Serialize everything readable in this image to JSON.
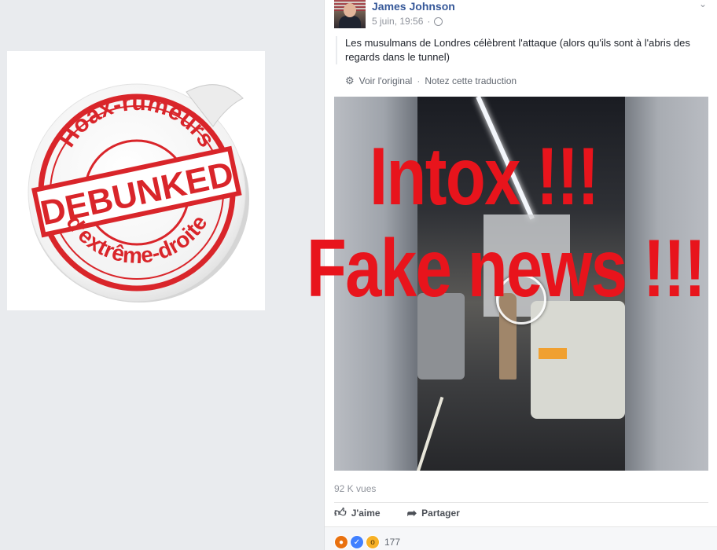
{
  "stamp": {
    "top_text": "Hoax-rumeurs",
    "band_text": "DEBUNKED",
    "bottom_text": "d'extrême-droite",
    "ink_color": "#d9252a"
  },
  "post": {
    "author": "James Johnson",
    "date": "5 juin, 19:56",
    "privacy_icon": "globe-icon",
    "text": "Les musulmans de Londres célèbrent l'attaque (alors qu'ils sont à l'abris des regards dans le tunnel)",
    "translation": {
      "see_original": "Voir l'original",
      "separator": "·",
      "rate_translation": "Notez cette traduction"
    }
  },
  "overlay": {
    "line1": "Intox !!!",
    "line2": "Fake news !!!",
    "color": "#e8141c"
  },
  "video": {
    "views": "92 K vues"
  },
  "actions": {
    "like": "J'aime",
    "share": "Partager"
  },
  "reactions": {
    "icons": [
      "angry-icon",
      "like-icon",
      "wow-icon"
    ],
    "count": "177"
  }
}
